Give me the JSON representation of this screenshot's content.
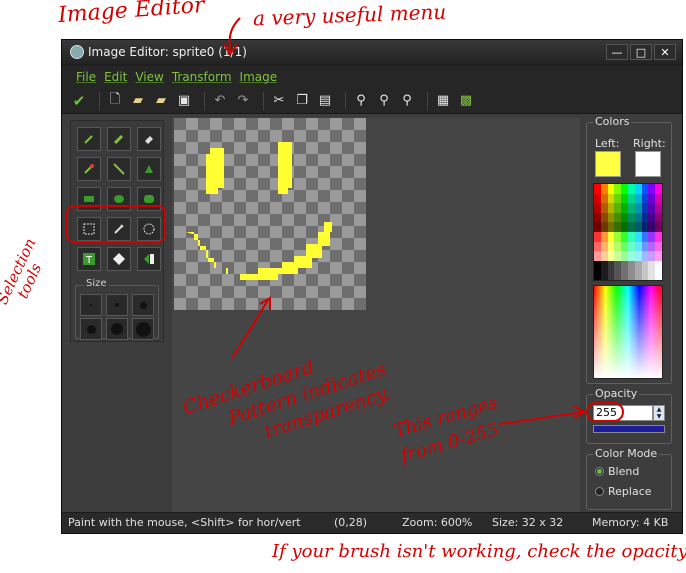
{
  "annotations": {
    "editor_label": "Image Editor",
    "menu_label": "a very useful menu",
    "selection_label_1": "Selection",
    "selection_label_2": "tools",
    "checker_1": "Checkerboard",
    "checker_2": "Pattern indicates",
    "checker_3": "transparency.",
    "range_1": "This ranges",
    "range_2": "from 0-255",
    "opacity_note": "If your brush isn't working, check the opacity."
  },
  "window": {
    "title": "Image Editor: sprite0 (1/1)",
    "min": "—",
    "max": "□",
    "close": "✕"
  },
  "menu": [
    "File",
    "Edit",
    "View",
    "Transform",
    "Image"
  ],
  "colors": {
    "panel_label": "Colors",
    "left_label": "Left:",
    "right_label": "Right:",
    "left_color": "#ffff44",
    "right_color": "#ffffff"
  },
  "tool_size_label": "Size",
  "opacity": {
    "label": "Opacity",
    "value": "255"
  },
  "color_mode": {
    "label": "Color Mode",
    "blend": "Blend",
    "replace": "Replace",
    "selected": "Blend"
  },
  "status": {
    "hint": "Paint with the mouse, <Shift> for hor/vert",
    "coords": "(0,28)",
    "zoom": "Zoom: 600%",
    "size": "Size: 32 x 32",
    "memory": "Memory: 4 KB"
  }
}
